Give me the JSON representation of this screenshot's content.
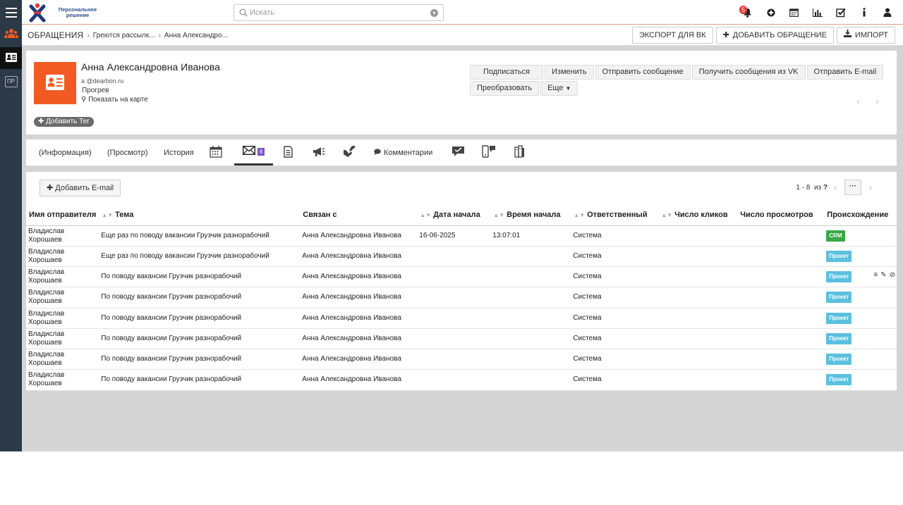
{
  "header": {
    "logo_text": "Персональное решение",
    "search_placeholder": "Искать",
    "notification_count": "5",
    "colors": {
      "sidebar": "#2c3a47",
      "accent": "#f25a24"
    }
  },
  "sidebar": {
    "items": [
      {
        "icon": "people-icon"
      },
      {
        "icon": "contact-card-icon",
        "active": true
      },
      {
        "label": "ПР"
      }
    ]
  },
  "breadcrumb": {
    "root": "ОБРАЩЕНИЯ",
    "level1": "Греются рассылк...",
    "level2": "Анна Александро..."
  },
  "page_actions": {
    "export": "ЭКСПОРТ ДЛЯ ВК",
    "add": "ДОБАВИТЬ ОБРАЩЕНИЕ",
    "import": "ИМПОРТ"
  },
  "record": {
    "name": "Анна Александровна Иванова",
    "email": "a          @dearbon.ru",
    "status": "Прогрев",
    "map_link": "Показать на карте",
    "add_tag": "Добавить Тег"
  },
  "record_actions": {
    "row1": [
      "Подписаться",
      "Изменить",
      "Отправить сообщение",
      "Получить сообщения из VK",
      "Отправить E-mail"
    ],
    "row2": [
      "Преобразовать",
      "Еще"
    ]
  },
  "tabs": {
    "info": "(Информация)",
    "view": "(Просмотр)",
    "history": "История",
    "email_count": "8",
    "comments": "Комментарии"
  },
  "list": {
    "add_button": "Добавить E-mail",
    "pager_range": "1 - 8",
    "pager_of": "из",
    "pager_total": "?",
    "columns": [
      "Имя отправителя",
      "Тема",
      "Связан с",
      "Дата начала",
      "Время начала",
      "Ответственный",
      "Число кликов",
      "Число просмотров",
      "Происхождение"
    ],
    "rows": [
      {
        "sender": "Владислав Хорошаев",
        "subject": "Еще раз по поводу вакансии Грузчик разнорабочий",
        "related": "Анна Александровна Иванова",
        "date": "16-06-2025",
        "time": "13:07:01",
        "owner": "Система",
        "clicks": "",
        "views": "",
        "origin": "CRM"
      },
      {
        "sender": "Владислав Хорошаев",
        "subject": "Еще раз по поводу вакансии Грузчик разнорабочий",
        "related": "Анна Александровна Иванова",
        "date": "",
        "time": "",
        "owner": "Система",
        "clicks": "",
        "views": "",
        "origin": "Проект"
      },
      {
        "sender": "Владислав Хорошаев",
        "subject": "По поводу вакансии Грузчик разнорабочий",
        "related": "Анна Александровна Иванова",
        "date": "",
        "time": "",
        "owner": "Система",
        "clicks": "",
        "views": "",
        "origin": "Проект"
      },
      {
        "sender": "Владислав Хорошаев",
        "subject": "По поводу вакансии Грузчик разнорабочий",
        "related": "Анна Александровна Иванова",
        "date": "",
        "time": "",
        "owner": "Система",
        "clicks": "",
        "views": "",
        "origin": "Проект"
      },
      {
        "sender": "Владислав Хорошаев",
        "subject": "По поводу вакансии Грузчик разнорабочий",
        "related": "Анна Александровна Иванова",
        "date": "",
        "time": "",
        "owner": "Система",
        "clicks": "",
        "views": "",
        "origin": "Проект"
      },
      {
        "sender": "Владислав Хорошаев",
        "subject": "По поводу вакансии Грузчик разнорабочий",
        "related": "Анна Александровна Иванова",
        "date": "",
        "time": "",
        "owner": "Система",
        "clicks": "",
        "views": "",
        "origin": "Проект"
      },
      {
        "sender": "Владислав Хорошаев",
        "subject": "По поводу вакансии Грузчик разнорабочий",
        "related": "Анна Александровна Иванова",
        "date": "",
        "time": "",
        "owner": "Система",
        "clicks": "",
        "views": "",
        "origin": "Проект"
      },
      {
        "sender": "Владислав Хорошаев",
        "subject": "По поводу вакансии Грузчик разнорабочий",
        "related": "Анна Александровна Иванова",
        "date": "",
        "time": "",
        "owner": "Система",
        "clicks": "",
        "views": "",
        "origin": "Проект"
      }
    ],
    "origin_colors": {
      "CRM": "#3aa74a",
      "Проект": "#5bc0de"
    }
  }
}
